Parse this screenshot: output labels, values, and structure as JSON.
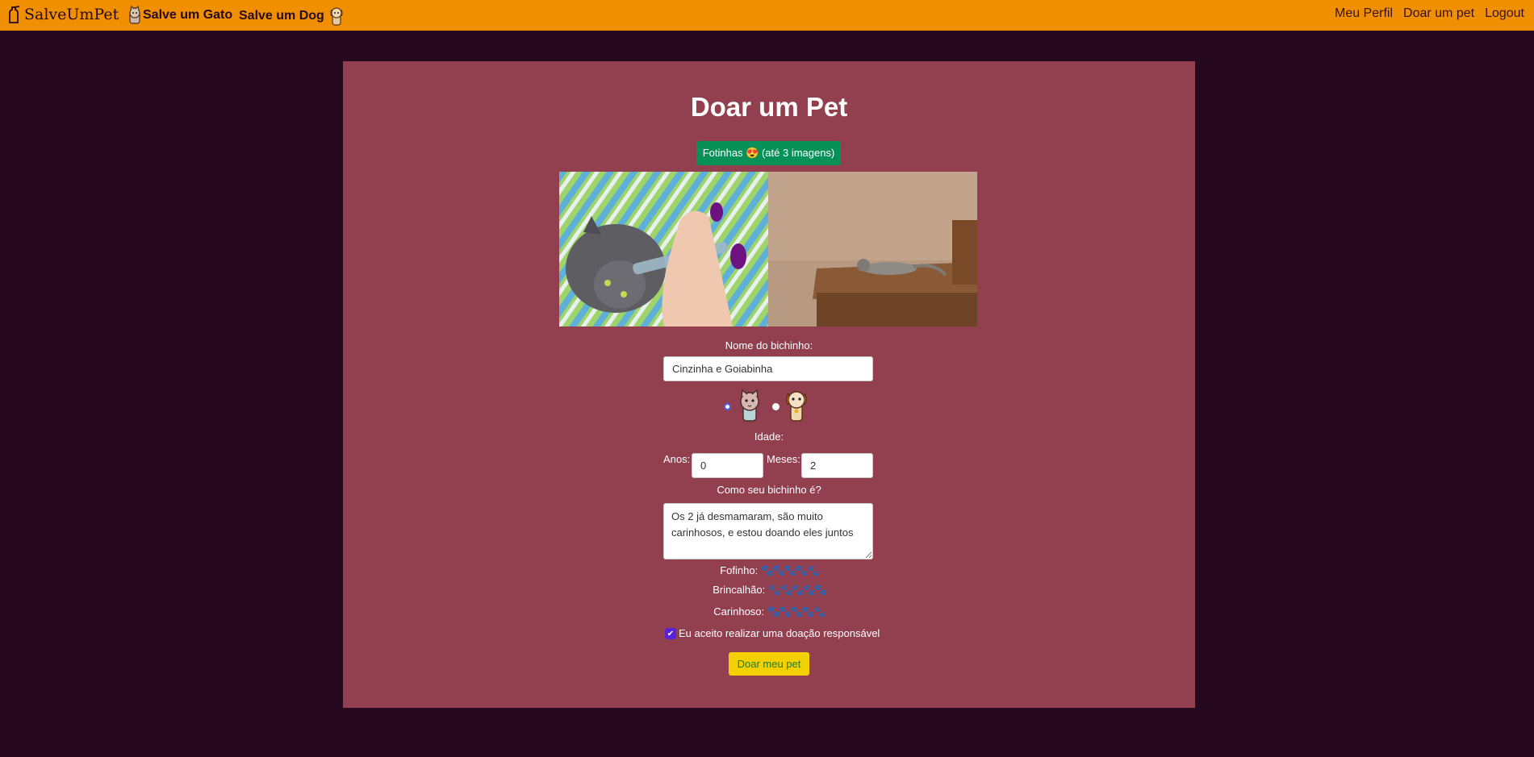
{
  "nav": {
    "brand": "SalveUmPet",
    "cat_link": "Salve um Gato",
    "dog_link": "Salve um Dog",
    "right_links": [
      "Meu Perfil",
      "Doar um pet",
      "Logout"
    ]
  },
  "form": {
    "title": "Doar um Pet",
    "photos_button": "Fotinhas 😍 (até 3 imagens)",
    "name_label": "Nome do bichinho:",
    "name_value": "Cinzinha e Goiabinha",
    "species_selected": "cat",
    "age_label": "Idade:",
    "years_label": "Anos:",
    "years_value": "0",
    "months_label": "Meses:",
    "months_value": "2",
    "description_label": "Como seu bichinho é?",
    "description_value": "Os 2 já desmamaram, são muito carinhosos, e estou doando eles juntos",
    "traits": [
      {
        "label": "Fofinho:",
        "stars": "🐾🐾🐾🐾🐾"
      },
      {
        "label": "Brincalhão:",
        "stars": "🐾🐾🐾🐾🐾"
      },
      {
        "label": "Carinhoso:",
        "stars": "🐾🐾🐾🐾🐾"
      }
    ],
    "accept_label": "Eu aceito realizar uma doação responsável",
    "accept_checked": true,
    "submit_label": "Doar meu pet"
  },
  "colors": {
    "navbar": "#f09001",
    "background": "#26081f",
    "panel": "#92404f",
    "photos_button": "#079058",
    "submit_button": "#f5d000"
  }
}
